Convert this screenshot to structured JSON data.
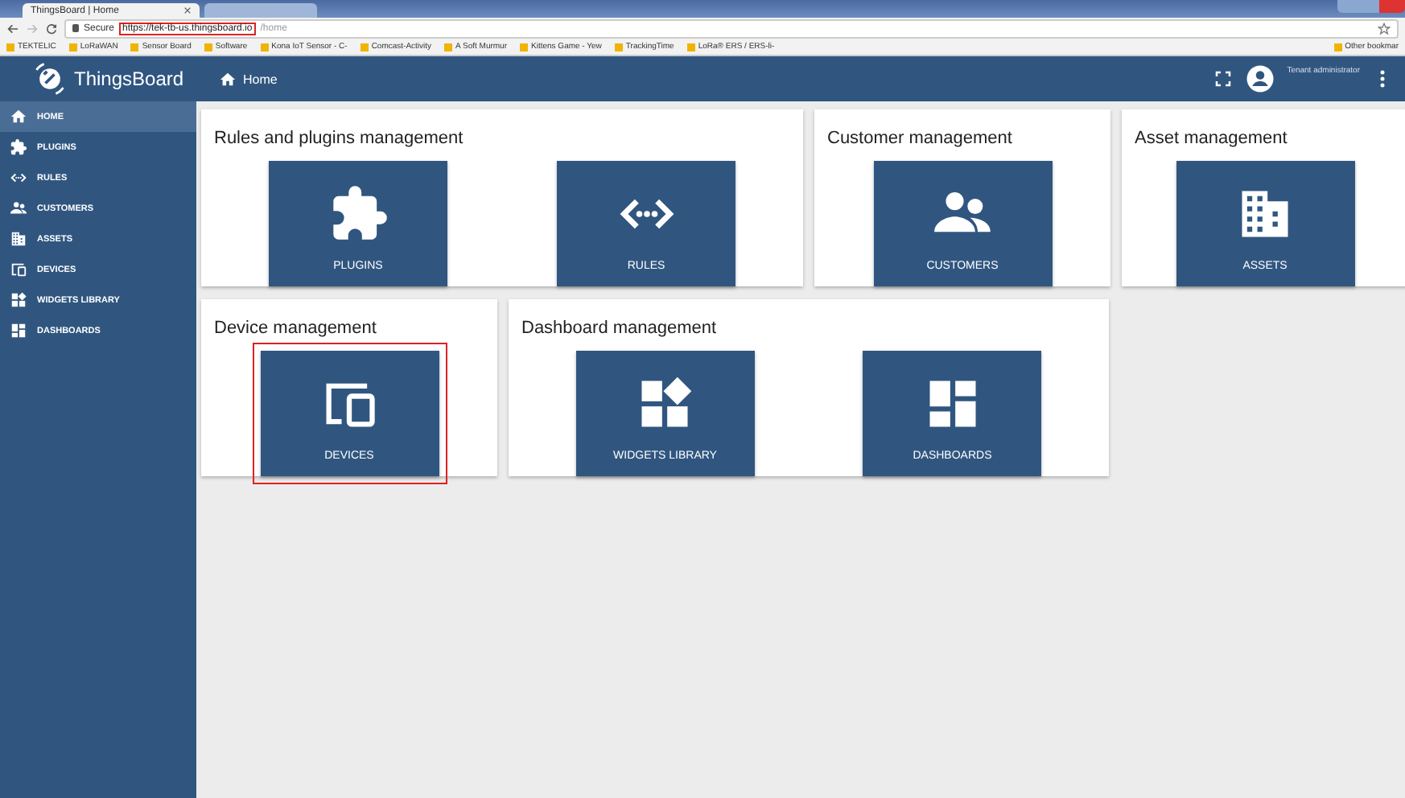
{
  "browser": {
    "tabs": [
      {
        "title": "ThingsBoard | Home",
        "selected": true
      },
      {
        "selected": false
      }
    ],
    "address": {
      "secure_label": "Secure",
      "url_host": "https://tek-tb-us.thingsboard.io",
      "url_path": "/home",
      "highlighted": true
    },
    "bookmarks": [
      "TEKTELIC",
      "LoRaWAN",
      "Sensor Board",
      "Software",
      "Kona IoT Sensor - C-",
      "Comcast-Activity",
      "A Soft Murmur",
      "Kittens Game - Yew",
      "TrackingTime",
      "LoRa® ERS / ERS-li-"
    ],
    "other_bookmarks": "Other bookmar"
  },
  "app": {
    "logo": "ThingsBoard",
    "breadcrumb": "Home",
    "user_role": "Tenant administrator"
  },
  "sidebar": {
    "items": [
      {
        "label": "HOME",
        "selected": true
      },
      {
        "label": "PLUGINS",
        "selected": false
      },
      {
        "label": "RULES",
        "selected": false
      },
      {
        "label": "CUSTOMERS",
        "selected": false
      },
      {
        "label": "ASSETS",
        "selected": false
      },
      {
        "label": "DEVICES",
        "selected": false
      },
      {
        "label": "WIDGETS LIBRARY",
        "selected": false
      },
      {
        "label": "DASHBOARDS",
        "selected": false
      }
    ]
  },
  "sections": [
    {
      "title": "Rules and plugins management",
      "tiles": [
        {
          "label": "PLUGINS",
          "highlighted": false
        },
        {
          "label": "RULES",
          "highlighted": false
        }
      ]
    },
    {
      "title": "Customer management",
      "tiles": [
        {
          "label": "CUSTOMERS",
          "highlighted": false
        }
      ]
    },
    {
      "title": "Asset management",
      "tiles": [
        {
          "label": "ASSETS",
          "highlighted": false
        }
      ]
    },
    {
      "title": "Device management",
      "tiles": [
        {
          "label": "DEVICES",
          "highlighted": true
        }
      ]
    },
    {
      "title": "Dashboard management",
      "tiles": [
        {
          "label": "WIDGETS LIBRARY",
          "highlighted": false
        },
        {
          "label": "DASHBOARDS",
          "highlighted": false
        }
      ]
    }
  ]
}
